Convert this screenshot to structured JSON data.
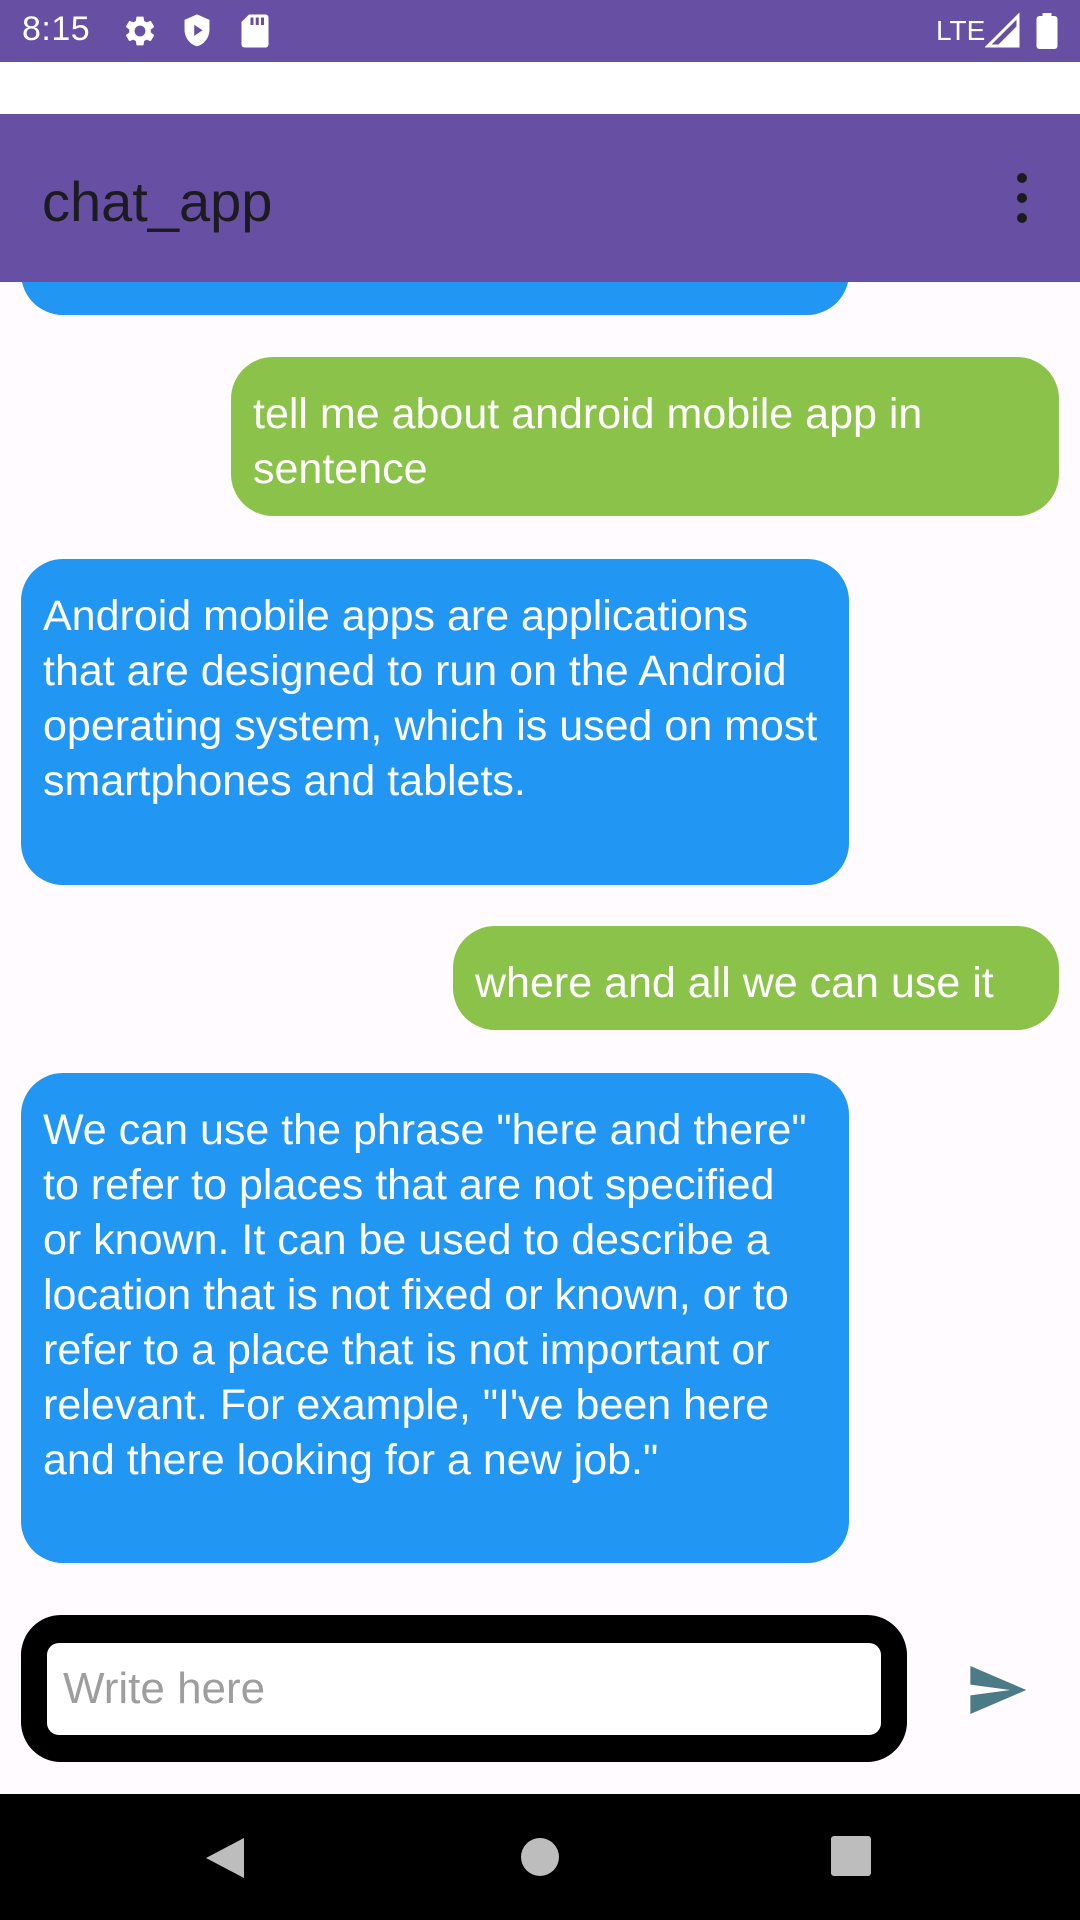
{
  "status_bar": {
    "time": "8:15",
    "network": "LTE",
    "icons": [
      "settings-icon",
      "play-protect-icon",
      "sd-card-icon",
      "signal-icon",
      "battery-icon"
    ]
  },
  "app_bar": {
    "title": "chat_app",
    "menu_icon": "more-vert-icon"
  },
  "colors": {
    "primary": "#6750a4",
    "bot_bubble": "#2196f3",
    "user_bubble": "#8bc34a",
    "send_icon": "#4a7b86"
  },
  "messages": [
    {
      "sender": "bot",
      "text": ""
    },
    {
      "sender": "user",
      "text": "tell me about android mobile app in sentence"
    },
    {
      "sender": "bot",
      "text": "Android mobile apps are applications that are designed to run on the Android operating system, which is used on most smartphones and tablets."
    },
    {
      "sender": "user",
      "text": "where and all we can use it"
    },
    {
      "sender": "bot",
      "text": "We can use the phrase \"here and there\" to refer to places that are not specified or known. It can be used to describe a location that is not fixed or known, or to refer to a place that is not important or relevant. For example, \"I've been here and there looking for a new job.\""
    }
  ],
  "composer": {
    "placeholder": "Write here",
    "value": "",
    "send_icon": "send-icon"
  },
  "nav_bar": {
    "buttons": [
      "back-icon",
      "home-icon",
      "recents-icon"
    ]
  }
}
